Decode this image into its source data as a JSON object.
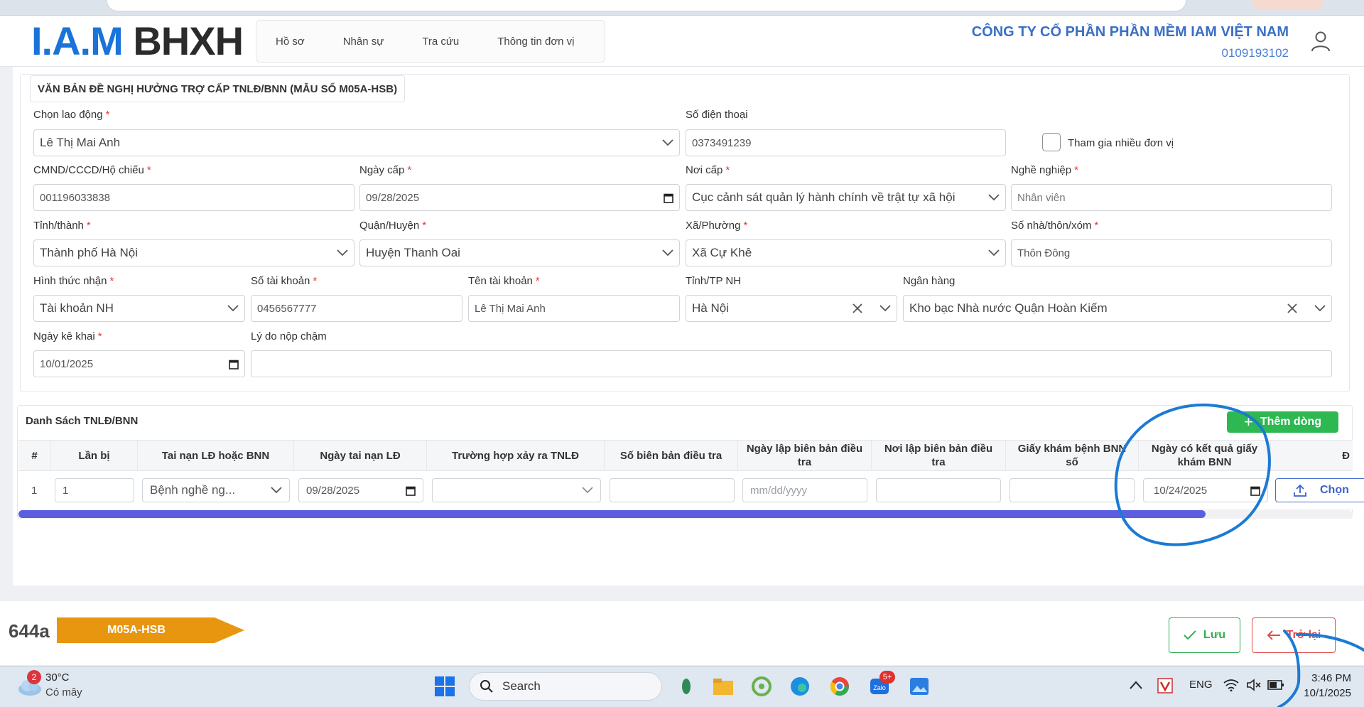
{
  "header": {
    "logo_iam": "I.A.M",
    "logo_bhxh": "BHXH",
    "nav": [
      "Hồ sơ",
      "Nhân sự",
      "Tra cứu",
      "Thông tin đơn vị"
    ],
    "company_name": "CÔNG TY CỔ PHẦN PHẦN MỀM IAM VIỆT NAM",
    "company_tax": "0109193102"
  },
  "form": {
    "title": "VĂN BẢN ĐỀ NGHỊ HƯỞNG TRỢ CẤP TNLĐ/BNN (MẪU SỐ M05A-HSB)",
    "labels": {
      "employee": "Chọn lao động",
      "phone": "Số điện thoại",
      "multi_unit": "Tham gia nhiều đơn vị",
      "id_number": "CMND/CCCD/Hộ chiếu",
      "issue_date": "Ngày cấp",
      "issue_place": "Nơi cấp",
      "occupation": "Nghề nghiệp",
      "province": "Tỉnh/thành",
      "district": "Quận/Huyện",
      "ward": "Xã/Phường",
      "address": "Số nhà/thôn/xóm",
      "receive_method": "Hình thức nhận",
      "account_number": "Số tài khoản",
      "account_name": "Tên tài khoản",
      "bank_province": "Tỉnh/TP NH",
      "bank": "Ngân hàng",
      "declare_date": "Ngày kê khai",
      "late_reason": "Lý do nộp chậm"
    },
    "values": {
      "employee": "Lê Thị Mai Anh",
      "phone": "0373491239",
      "id_number": "001196033838",
      "issue_date": "09/28/2025",
      "issue_place": "Cục cảnh sát quản lý hành chính về trật tự xã hội",
      "occupation": "Nhân viên",
      "province": "Thành phố Hà Nội",
      "district": "Huyện Thanh Oai",
      "ward": "Xã Cự Khê",
      "address": "Thôn Đông",
      "receive_method": "Tài khoản NH",
      "account_number": "0456567777",
      "account_name": "Lê Thị Mai Anh",
      "bank_province": "Hà Nội",
      "bank": "Kho bạc Nhà nước Quận Hoàn Kiếm",
      "declare_date": "10/01/2025",
      "late_reason": ""
    }
  },
  "list": {
    "title": "Danh Sách TNLĐ/BNN",
    "add_button": "Thêm dòng",
    "columns": [
      "#",
      "Lần bị",
      "Tai nạn LĐ hoặc BNN",
      "Ngày tai nạn LĐ",
      "Trường hợp xảy ra TNLĐ",
      "Số biên bản điều tra",
      "Ngày lập biên bản điều tra",
      "Nơi lập biên bản điều tra",
      "Giấy khám bệnh BNN số",
      "Ngày có kết quả giấy khám BNN",
      "Đ"
    ],
    "rows": [
      {
        "index": "1",
        "times": "1",
        "type": "Bệnh nghề ng...",
        "accident_date": "09/28/2025",
        "case": "",
        "report_number": "",
        "report_date_placeholder": "mm/dd/yyyy",
        "report_place": "",
        "exam_number": "",
        "exam_result_date": "10/24/2025",
        "choose_label": "Chọn"
      }
    ],
    "scroll_progress": 0.89
  },
  "footer": {
    "code": "644a",
    "form_tag": "M05A-HSB",
    "save": "Lưu",
    "back": "Trở lại",
    "tag_color": "#e8960f"
  },
  "taskbar": {
    "weather_temp": "30°C",
    "weather_desc": "Có mây",
    "weather_badge": "2",
    "search": "Search",
    "zalo_badge": "5+",
    "lang": "ENG",
    "time": "3:46 PM",
    "date": "10/1/2025"
  },
  "annotation_color": "#1c7ad4"
}
